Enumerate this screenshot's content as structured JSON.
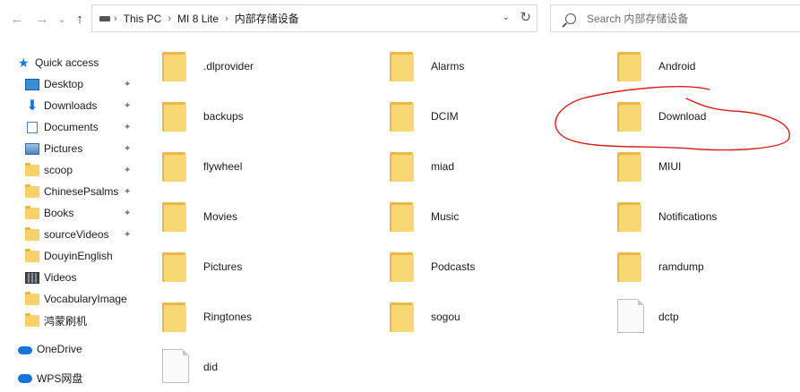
{
  "toolbar": {
    "back": "←",
    "forward": "→",
    "recent": "⌄",
    "up": "↑"
  },
  "address": {
    "crumbs": [
      "This PC",
      "MI 8 Lite",
      "内部存储设备"
    ],
    "separator": "›",
    "dropdown": "⌄",
    "refresh": "↻"
  },
  "search": {
    "placeholder": "Search 内部存储设备"
  },
  "sidebar": {
    "quick_access": "Quick access",
    "items": [
      {
        "label": "Desktop",
        "pinned": true
      },
      {
        "label": "Downloads",
        "pinned": true
      },
      {
        "label": "Documents",
        "pinned": true
      },
      {
        "label": "Pictures",
        "pinned": true
      },
      {
        "label": "scoop",
        "pinned": true
      },
      {
        "label": "ChinesePsalms",
        "pinned": true
      },
      {
        "label": "Books",
        "pinned": true
      },
      {
        "label": "sourceVideos",
        "pinned": true
      },
      {
        "label": "DouyinEnglish",
        "pinned": false
      },
      {
        "label": "Videos",
        "pinned": false
      },
      {
        "label": "VocabularyImage",
        "pinned": false
      },
      {
        "label": "鸿蒙刷机",
        "pinned": false
      }
    ],
    "onedrive": "OneDrive",
    "wps": "WPS网盘",
    "pin_glyph": "📌"
  },
  "content": {
    "items": [
      {
        "name": ".dlprovider",
        "type": "folder"
      },
      {
        "name": "Alarms",
        "type": "folder"
      },
      {
        "name": "Android",
        "type": "folder"
      },
      {
        "name": "backups",
        "type": "folder"
      },
      {
        "name": "DCIM",
        "type": "folder"
      },
      {
        "name": "Download",
        "type": "folder"
      },
      {
        "name": "flywheel",
        "type": "folder"
      },
      {
        "name": "miad",
        "type": "folder"
      },
      {
        "name": "MIUI",
        "type": "folder"
      },
      {
        "name": "Movies",
        "type": "folder"
      },
      {
        "name": "Music",
        "type": "folder"
      },
      {
        "name": "Notifications",
        "type": "folder"
      },
      {
        "name": "Pictures",
        "type": "folder"
      },
      {
        "name": "Podcasts",
        "type": "folder"
      },
      {
        "name": "ramdump",
        "type": "folder"
      },
      {
        "name": "Ringtones",
        "type": "folder"
      },
      {
        "name": "sogou",
        "type": "folder"
      },
      {
        "name": "dctp",
        "type": "file"
      },
      {
        "name": "did",
        "type": "file"
      }
    ]
  },
  "colors": {
    "annotation": "#d91e1e",
    "folder_front": "#f8d775",
    "folder_back": "#e7b74a",
    "onedrive": "#1a73d9"
  }
}
